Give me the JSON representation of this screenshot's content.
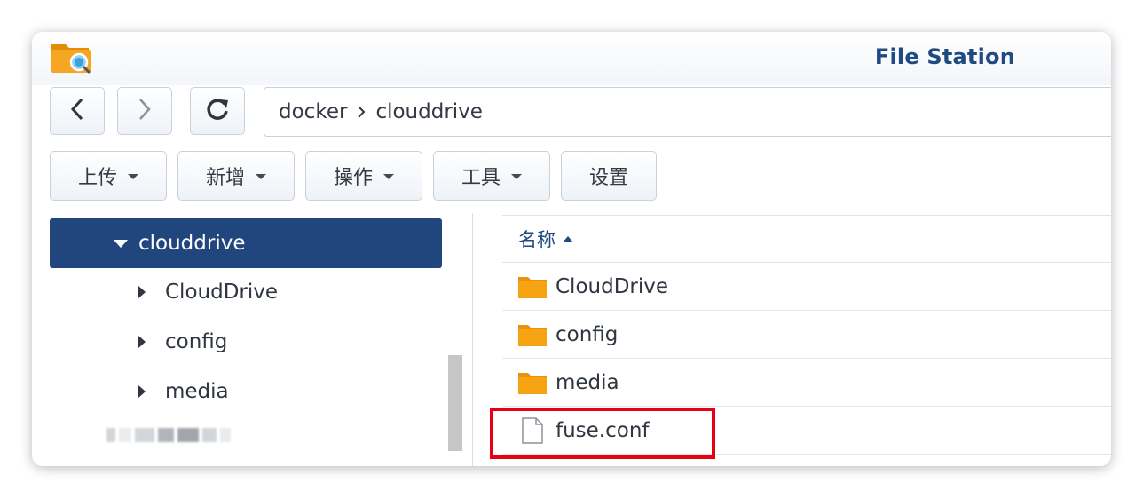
{
  "app": {
    "title": "File Station",
    "icon": "folder-magnifier-icon"
  },
  "navigation": {
    "back_icon": "chevron-left-icon",
    "forward_icon": "chevron-right-icon",
    "refresh_icon": "refresh-icon",
    "path": [
      "docker",
      "clouddrive"
    ]
  },
  "toolbar": {
    "upload_label": "上传",
    "create_label": "新增",
    "action_label": "操作",
    "tools_label": "工具",
    "settings_label": "设置"
  },
  "tree": {
    "selected": "clouddrive",
    "children": [
      "CloudDrive",
      "config",
      "media"
    ]
  },
  "file_list": {
    "column_name": "名称",
    "rows": [
      {
        "name": "CloudDrive",
        "type": "folder"
      },
      {
        "name": "config",
        "type": "folder"
      },
      {
        "name": "media",
        "type": "folder"
      },
      {
        "name": "fuse.conf",
        "type": "file"
      }
    ]
  },
  "colors": {
    "accent": "#21467e",
    "title": "#1f4a82",
    "folder": "#f7a414",
    "highlight": "#e60012"
  }
}
